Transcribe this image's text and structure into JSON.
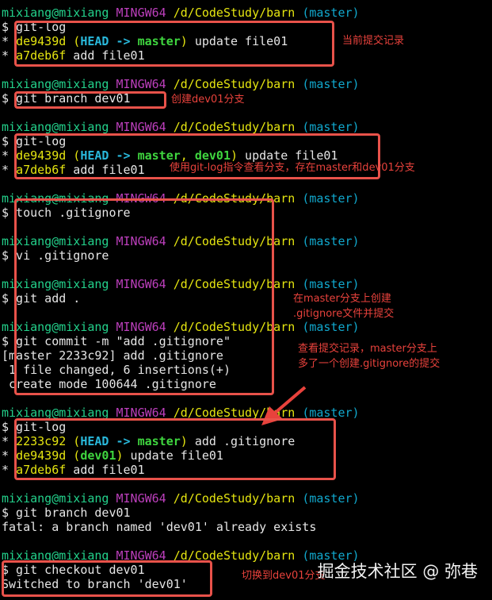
{
  "prompt": {
    "user": "mixiang@mixiang",
    "env": "MINGW64",
    "path": "/d/CodeStudy/barn",
    "branch": "(master)"
  },
  "blocks": [
    {
      "commands": [
        "$ git-log"
      ],
      "output": [
        {
          "star": "* ",
          "hash": "de9439d",
          "refs": [
            {
              "t": "HEAD -> ",
              "c": "h"
            },
            {
              "t": "master",
              "c": "g"
            }
          ],
          "msg": " update file01"
        },
        {
          "star": "* ",
          "hash": "a7deb6f",
          "refs": [],
          "msg": " add file01"
        }
      ]
    },
    {
      "commands": [
        "$ git branch dev01"
      ],
      "output": []
    },
    {
      "commands": [
        "$ git-log"
      ],
      "output": [
        {
          "star": "* ",
          "hash": "de9439d",
          "refs": [
            {
              "t": "HEAD -> ",
              "c": "h"
            },
            {
              "t": "master",
              "c": "g"
            },
            {
              "t": ", ",
              "c": "y"
            },
            {
              "t": "dev01",
              "c": "g"
            }
          ],
          "msg": " update file01"
        },
        {
          "star": "* ",
          "hash": "a7deb6f",
          "refs": [],
          "msg": " add file01"
        }
      ]
    },
    {
      "commands": [
        "$ touch .gitignore"
      ],
      "output": []
    },
    {
      "commands": [
        "$ vi .gitignore"
      ],
      "output": []
    },
    {
      "commands": [
        "$ git add ."
      ],
      "output": []
    },
    {
      "commands": [
        "$ git commit -m \"add .gitignore\""
      ],
      "output": [
        {
          "text": "[master 2233c92] add .gitignore"
        },
        {
          "text": " 1 file changed, 6 insertions(+)"
        },
        {
          "text": " create mode 100644 .gitignore"
        }
      ]
    },
    {
      "commands": [
        "$ git-log"
      ],
      "output": [
        {
          "star": "* ",
          "hash": "2233c92",
          "refs": [
            {
              "t": "HEAD -> ",
              "c": "h"
            },
            {
              "t": "master",
              "c": "g"
            }
          ],
          "msg": " add .gitignore"
        },
        {
          "star": "* ",
          "hash": "de9439d",
          "refs": [
            {
              "t": "dev01",
              "c": "g"
            }
          ],
          "msg": " update file01"
        },
        {
          "star": "* ",
          "hash": "a7deb6f",
          "refs": [],
          "msg": " add file01"
        }
      ]
    },
    {
      "commands": [
        "$ git branch dev01"
      ],
      "output": [
        {
          "text": "fatal: a branch named 'dev01' already exists"
        }
      ]
    },
    {
      "commands": [
        "$ git checkout dev01"
      ],
      "output": [
        {
          "text": "Switched to branch 'dev01'"
        }
      ]
    }
  ],
  "annotations": [
    {
      "text": "当前提交记录"
    },
    {
      "text": "创建dev01分支"
    },
    {
      "text": "使用git-log指令查看分支，存在master和dev01分支"
    },
    {
      "text": "在master分支上创建\n.gitignore文件并提交"
    },
    {
      "text": "查看提交记录，master分支上\n多了一个创建.gitignore的提交"
    },
    {
      "text": "切换到dev01分支"
    }
  ],
  "watermark": "掘金技术社区 @ 弥巷",
  "colors": {
    "annotation": "#e8423c",
    "box": "#e8524a",
    "user": "#23d18b",
    "env": "#bc3fbc",
    "path": "#e5e510",
    "branch": "#11a8cd"
  }
}
